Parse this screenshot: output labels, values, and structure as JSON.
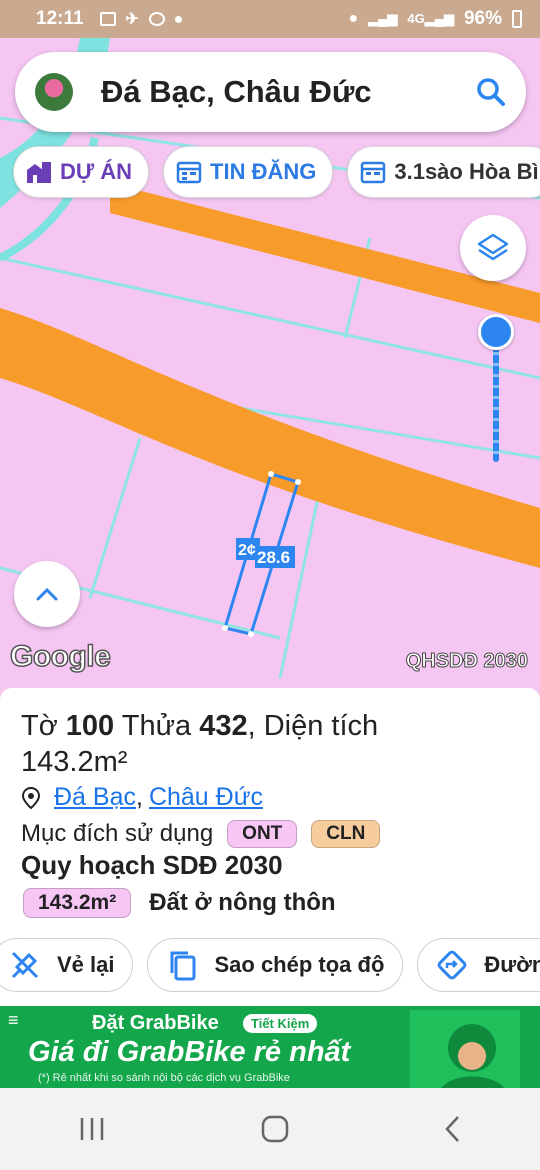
{
  "status_bar": {
    "time": "12:11",
    "battery": "96%"
  },
  "search": {
    "title": "Đá Bạc, Châu Đức",
    "icon": "search-icon"
  },
  "chips": [
    {
      "label": "DỰ ÁN",
      "icon": "building-icon"
    },
    {
      "label": "TIN ĐĂNG",
      "icon": "calendar-icon"
    },
    {
      "label": "3.1sào Hòa Bì",
      "icon": "calendar-icon"
    }
  ],
  "map": {
    "parcel_labels": [
      "2¢",
      "28.6"
    ],
    "google_logo": "Google",
    "plan_layer": "QHSDĐ 2030",
    "colors": {
      "land": "#f6c6f3",
      "road": "#f79b2a",
      "water": "#7ee3e0",
      "parcel": "#2d86f0"
    }
  },
  "info": {
    "prefix_to": "Tờ",
    "sheet": "100",
    "prefix_thua": "Thửa",
    "parcel": "432",
    "area_text": ", Diện tích",
    "area": "143.2m²",
    "location_1": "Đá Bạc",
    "location_2": "Châu Đức",
    "purpose_label": "Mục đích sử dụng",
    "purpose_badges": [
      "ONT",
      "CLN"
    ],
    "plan_title": "Quy hoạch SDĐ 2030",
    "plan_area": "143.2m²",
    "plan_desc": "Đất ở nông thôn"
  },
  "actions": [
    {
      "label": "Vẻ lại",
      "icon": "redraw-icon"
    },
    {
      "label": "Sao chép tọa độ",
      "icon": "copy-icon"
    },
    {
      "label": "Đườn",
      "icon": "directions-icon"
    }
  ],
  "ad": {
    "line1": "Đặt GrabBike",
    "tag": "Tiết Kiệm",
    "line2": "Giá đi GrabBike rẻ nhất",
    "line3": "(*) Rẻ nhất khi so sánh nội bộ các dịch vụ GrabBike"
  }
}
